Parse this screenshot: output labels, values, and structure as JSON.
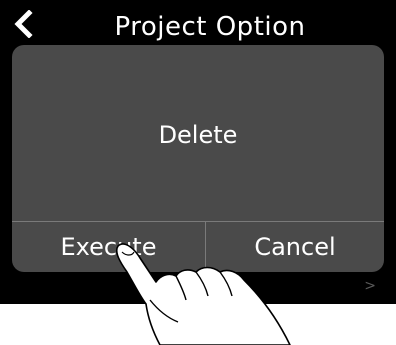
{
  "header": {
    "title": "Project Option",
    "back_icon": "chevron-left-icon"
  },
  "dialog": {
    "message": "Delete",
    "buttons": {
      "execute_label": "Execute",
      "cancel_label": "Cancel"
    }
  },
  "background": {
    "chevron_glyph": ">"
  },
  "colors": {
    "screen_bg": "#000000",
    "dialog_bg": "#4a4a4a",
    "divider": "#7a7a7a",
    "text": "#ffffff"
  }
}
